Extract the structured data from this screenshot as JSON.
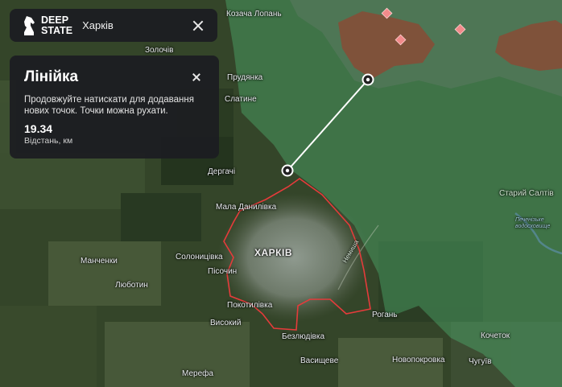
{
  "header": {
    "logo_line1": "DEEP",
    "logo_line2": "STATE",
    "location": "Харків"
  },
  "ruler_panel": {
    "title": "Лінійка",
    "description": "Продовжуйте натискати для додавання нових точок. Точки можна рухати.",
    "distance_value": "19.34",
    "distance_unit": "Відстань, км"
  },
  "places": {
    "kozacha_lopan": "Козача Лопань",
    "zolochiv": "Золочів",
    "prudianka": "Прудянка",
    "slatyne": "Слатине",
    "derhachi": "Дергачі",
    "mala_danylivka": "Мала Данилівка",
    "kharkiv": "ХАРКІВ",
    "manchenky": "Манченки",
    "solonytsivka": "Солоницівка",
    "pisochyn": "Пісочин",
    "liubotyn": "Люботин",
    "pokotylivka": "Покотилівка",
    "vysokyi": "Високий",
    "bezliudivka": "Безлюдівка",
    "merefa": "Мерефа",
    "vasyshcheve": "Васищеве",
    "novopokrovka": "Новопокровка",
    "rohan": "Рогань",
    "staryi_saltiv": "Старий Салтів",
    "kochetok": "Кочеток",
    "chuhuiv": "Чугуїв",
    "road_label": "Немиша",
    "water_label": "Печенізьке водосховище"
  },
  "colors": {
    "occupied_zone": "#8a4a35",
    "gray_zone": "#4fb273",
    "city_boundary": "#e53b3b",
    "ruler_line": "#ffffff",
    "panel_bg": "#1c1e22"
  }
}
